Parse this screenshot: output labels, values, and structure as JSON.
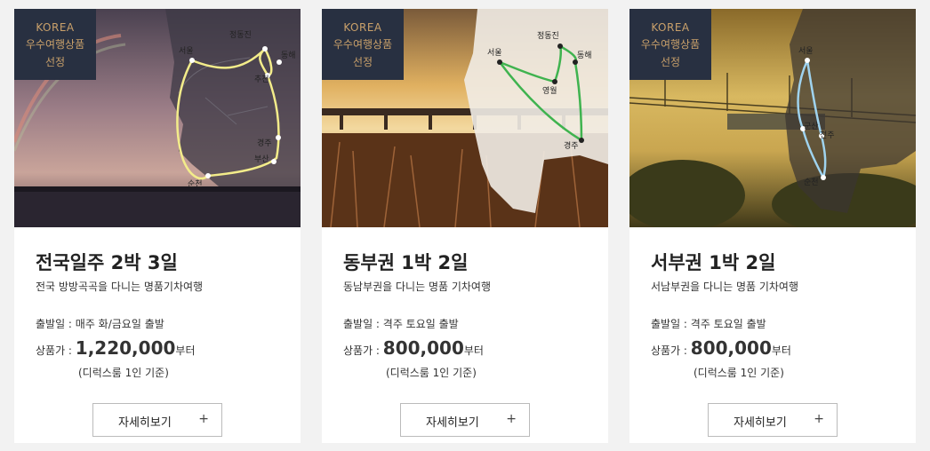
{
  "badge": {
    "line1": "KOREA",
    "line2": "우수여행상품",
    "line3": "선정"
  },
  "cards": [
    {
      "title": "전국일주 2박 3일",
      "subtitle": "전국 방방곡곡을 다니는 명품기차여행",
      "depart": "출발일 : 매주 화/금요일 출발",
      "price_label": "상품가 : ",
      "price": "1,220,000",
      "price_suffix": "부터",
      "note": "(디럭스룸 1인 기준)",
      "button": "자세히보기",
      "plus": "+",
      "route_color": "#f3ec8a",
      "cities": [
        "정동진",
        "서울",
        "동해",
        "추천",
        "경주",
        "부산",
        "순천"
      ]
    },
    {
      "title": "동부권 1박 2일",
      "subtitle": "동남부권을 다니는 명품 기차여행",
      "depart": "출발일 : 격주 토요일 출발",
      "price_label": "상품가 : ",
      "price": "800,000",
      "price_suffix": "부터",
      "note": "(디럭스룸 1인 기준)",
      "button": "자세히보기",
      "plus": "+",
      "route_color": "#3fb34f",
      "cities": [
        "정동진",
        "서울",
        "동해",
        "영월",
        "경주"
      ]
    },
    {
      "title": "서부권 1박 2일",
      "subtitle": "서남부권을 다니는 명품 기차여행",
      "depart": "출발일 : 격주 토요일 출발",
      "price_label": "상품가 : ",
      "price": "800,000",
      "price_suffix": "부터",
      "note": "(디럭스룸 1인 기준)",
      "button": "자세히보기",
      "plus": "+",
      "route_color": "#9fd3ef",
      "cities": [
        "서울",
        "군산",
        "전주",
        "순천"
      ]
    }
  ]
}
